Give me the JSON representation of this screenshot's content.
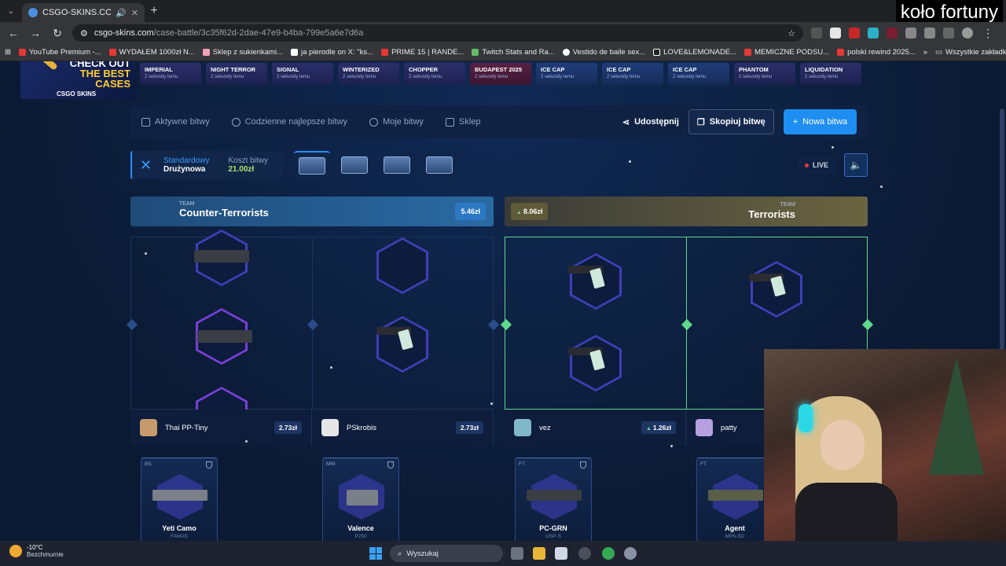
{
  "browser": {
    "tab_title": "CSGO-SKINS.COM - Najlep",
    "url_domain": "csgo-skins.com",
    "url_path": "/case-battle/3c35f62d-2dae-47e9-b4ba-799e5a6e7d6a",
    "bookmarks": [
      "YouTube Premium -...",
      "WYDAŁEM 1000zł N...",
      "Sklep z sukienkami...",
      "ja pierodle on X: \"ks...",
      "PRIME 15 | RANDE...",
      "Twitch Stats and Ra...",
      "Vestido de baile sex...",
      "LOVE&LEMONADE...",
      "MEMICZNE PODSU...",
      "polski rewind 2025..."
    ],
    "bookmarks_right": "Wszystkie zakładki"
  },
  "overlay_title": "koło fortuny",
  "promo": {
    "line1": "CHECK OUT",
    "line2": "THE BEST",
    "line3": "CASES",
    "brand": "CSGO SKINS"
  },
  "ticker": [
    {
      "name": "IMPERIAL",
      "time": "2 sekundy temu"
    },
    {
      "name": "NIGHT TERROR",
      "time": "2 sekundy temu"
    },
    {
      "name": "SIGNAL",
      "time": "2 sekundy temu"
    },
    {
      "name": "WINTERIZED",
      "time": "2 sekundy temu"
    },
    {
      "name": "CHOPPER",
      "time": "2 sekundy temu"
    },
    {
      "name": "BUDAPEST 2025",
      "time": "2 sekundy temu"
    },
    {
      "name": "ICE CAP",
      "time": "2 sekundy temu"
    },
    {
      "name": "ICE CAP",
      "time": "2 sekundy temu"
    },
    {
      "name": "ICE CAP",
      "time": "2 sekundy temu"
    },
    {
      "name": "PHANTOM",
      "time": "2 sekundy temu"
    },
    {
      "name": "LIQUIDATION",
      "time": "2 sekundy temu"
    }
  ],
  "nav": {
    "active_battles": "Aktywne bitwy",
    "daily_best": "Codzienne najlepsze bitwy",
    "my_battles": "Moje bitwy",
    "shop": "Sklep",
    "share": "Udostępnij",
    "copy_battle": "Skopiuj bitwę",
    "new_battle": "Nowa bitwa"
  },
  "mode": {
    "type": "Standardowy",
    "team": "Drużynowa",
    "cost_label": "Koszt bitwy",
    "cost_value": "21.00zł"
  },
  "live_label": "LIVE",
  "teams": {
    "ct": {
      "label": "TEAM",
      "name": "Counter-Terrorists",
      "score": "5.46zł"
    },
    "t": {
      "label": "TEAM",
      "name": "Terrorists",
      "score": "8.06zł"
    }
  },
  "players": [
    {
      "name": "Thai PP-Tiny",
      "value": "2.73zł"
    },
    {
      "name": "PSkrobis",
      "value": "2.73zł"
    },
    {
      "name": "vez",
      "value": "1.26zł"
    },
    {
      "name": "patty",
      "value": ""
    }
  ],
  "items": [
    {
      "wear": "BS",
      "name": "Yeti Camo",
      "weapon": "FAMAS"
    },
    {
      "wear": "MW",
      "name": "Valence",
      "weapon": "P250"
    },
    {
      "wear": "FT",
      "name": "PC-GRN",
      "weapon": "USP-S"
    },
    {
      "wear": "FT",
      "name": "Agent",
      "weapon": "MP5-SD"
    }
  ],
  "taskbar": {
    "temperature": "-10°C",
    "weather": "Bezchmurnie",
    "search": "Wyszukaj"
  }
}
